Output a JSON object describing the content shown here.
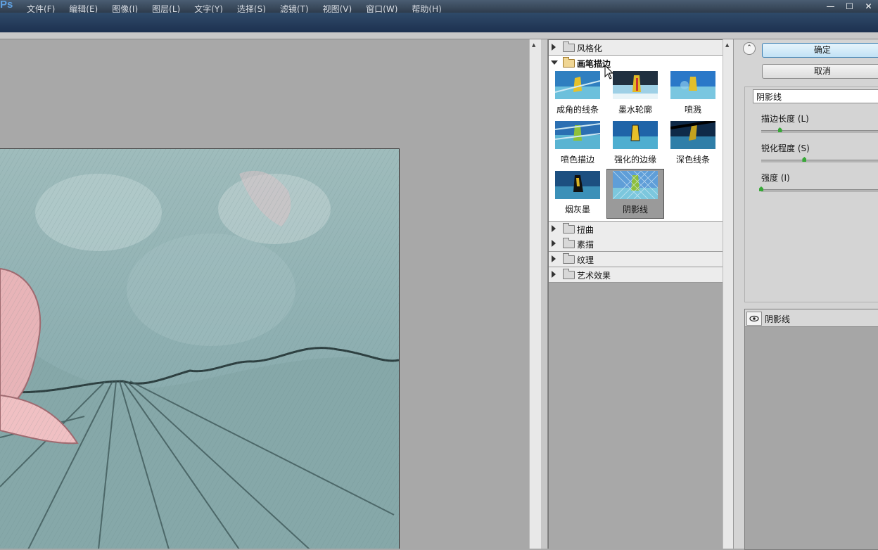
{
  "app": {
    "logo": "Ps"
  },
  "menu": [
    "文件(F)",
    "编辑(E)",
    "图像(I)",
    "图层(L)",
    "文字(Y)",
    "选择(S)",
    "滤镜(T)",
    "视图(V)",
    "窗口(W)",
    "帮助(H)"
  ],
  "window_controls": {
    "minimize": "—",
    "maximize": "☐",
    "close": "✕"
  },
  "gallery": {
    "categories_top": [
      {
        "label": "风格化",
        "expanded": false
      }
    ],
    "open_category": {
      "label": "画笔描边",
      "expanded": true
    },
    "thumbnails": [
      {
        "label": "成角的线条",
        "selected": false
      },
      {
        "label": "墨水轮廓",
        "selected": false
      },
      {
        "label": "喷溅",
        "selected": false
      },
      {
        "label": "喷色描边",
        "selected": false
      },
      {
        "label": "强化的边缘",
        "selected": false
      },
      {
        "label": "深色线条",
        "selected": false
      },
      {
        "label": "烟灰墨",
        "selected": false
      },
      {
        "label": "阴影线",
        "selected": true
      }
    ],
    "categories_bottom": [
      {
        "label": "扭曲",
        "expanded": false
      },
      {
        "label": "素描",
        "expanded": false
      },
      {
        "label": "纹理",
        "expanded": false
      },
      {
        "label": "艺术效果",
        "expanded": false
      }
    ]
  },
  "dialog": {
    "ok_label": "确定",
    "cancel_label": "取消",
    "selected_filter": "阴影线",
    "params": [
      {
        "label": "描边长度 (L)",
        "value_fraction": 0.16
      },
      {
        "label": "锐化程度 (S)",
        "value_fraction": 0.37
      },
      {
        "label": "强度 (I)",
        "value_fraction": 0.0
      }
    ]
  },
  "effect_layers": [
    {
      "name": "阴影线",
      "visible": true
    }
  ],
  "colors": {
    "accent_button": "#c2e2f5",
    "menubar": "#3a4b5e",
    "slider_thumb": "#38a838"
  }
}
